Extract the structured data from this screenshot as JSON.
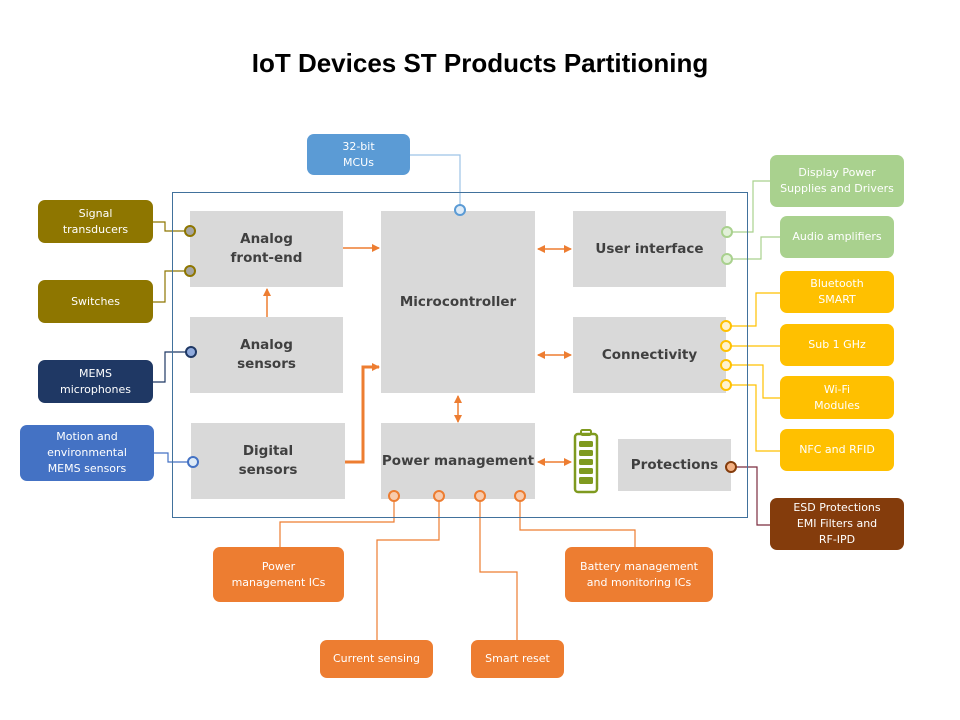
{
  "title": "IoT Devices ST Products Partitioning",
  "blocks": {
    "analog_front_end": "Analog\nfront-end",
    "analog_sensors": "Analog\nsensors",
    "digital_sensors": "Digital\nsensors",
    "microcontroller": "Microcontroller",
    "power_management": "Power management",
    "user_interface": "User interface",
    "connectivity": "Connectivity",
    "protections": "Protections"
  },
  "products": {
    "mcus": "32-bit\nMCUs",
    "signal_transducers": "Signal\ntransducers",
    "switches": "Switches",
    "mems_microphones": "MEMS\nmicrophones",
    "motion_sensors": "Motion and\nenvironmental\nMEMS sensors",
    "display_power": "Display Power\nSupplies and Drivers",
    "audio_amplifiers": "Audio amplifiers",
    "bluetooth": "Bluetooth\nSMART",
    "sub1ghz": "Sub 1 GHz",
    "wifi": "Wi-Fi\nModules",
    "nfc_rfid": "NFC and RFID",
    "esd": "ESD Protections\nEMI Filters and\nRF-IPD",
    "power_ics": "Power\nmanagement  ICs",
    "battery_mgmt": "Battery management\nand monitoring ICs",
    "current_sensing": "Current sensing",
    "smart_reset": "Smart reset"
  },
  "icons": {
    "battery": "battery-icon"
  },
  "colors": {
    "block_bg": "#d9d9d9",
    "frame": "#41719c",
    "arrow": "#ed7d31",
    "mcu_blue": "#5b9bd5",
    "olive": "#8e7600",
    "navy": "#1f3864",
    "blue": "#4472c4",
    "green": "#a9d18e",
    "yellow": "#ffc000",
    "brown": "#843c0c",
    "orange": "#ed7d31"
  }
}
